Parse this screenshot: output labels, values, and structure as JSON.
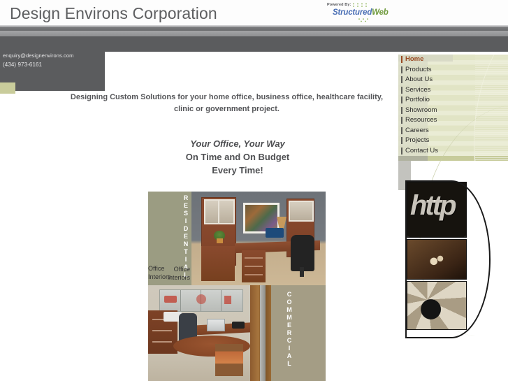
{
  "site": {
    "title": "Design Environs Corporation"
  },
  "powered": {
    "label": "Powered By:",
    "brand_first": "Structured",
    "brand_second": "Web",
    "color_first": "#4a6fb5",
    "color_second": "#6f9a3c"
  },
  "contact": {
    "email": "enquiry@designenvirons.com",
    "phone": "(434) 973-6161"
  },
  "nav": {
    "active_color": "#9a4a22",
    "items": [
      {
        "label": "Home",
        "active": true
      },
      {
        "label": "Products",
        "active": false
      },
      {
        "label": "About Us",
        "active": false
      },
      {
        "label": "Services",
        "active": false
      },
      {
        "label": "Portfolio",
        "active": false
      },
      {
        "label": "Showroom",
        "active": false
      },
      {
        "label": "Resources",
        "active": false
      },
      {
        "label": "Careers",
        "active": false
      },
      {
        "label": "Projects",
        "active": false
      },
      {
        "label": "Contact Us",
        "active": false
      }
    ]
  },
  "main": {
    "tagline_line1": "Designing Custom Solutions for your home office, business office, healthcare facility,",
    "tagline_line2": "clinic or government project.",
    "slogan_line1": "Your Office, Your Way",
    "slogan_line2": "On Time and On Budget",
    "slogan_line3": "Every Time!"
  },
  "collage": {
    "residential": {
      "vertical_label": "RESIDENTIAL",
      "caption_line1": "Office",
      "caption_line2": "Interiors"
    },
    "commercial": {
      "vertical_label": "COMMERCIAL",
      "caption_line1": "Office",
      "caption_line2": "Interiors"
    }
  },
  "decor": {
    "http_text": "http",
    "images": [
      "http-sign-photo",
      "hands-photo",
      "gears-photo"
    ]
  },
  "theme": {
    "olive": "#c7cb9b",
    "header_gray": "#5b5c5e",
    "title_gray": "#5d5e60"
  }
}
